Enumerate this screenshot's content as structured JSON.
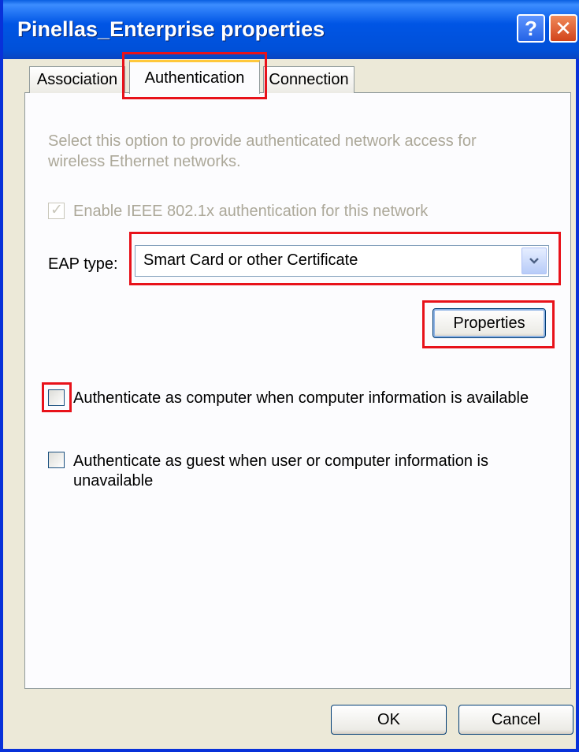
{
  "window": {
    "title": "Pinellas_Enterprise properties",
    "help_label": "?",
    "close_label": "✕"
  },
  "tabs": [
    {
      "label": "Association"
    },
    {
      "label": "Authentication"
    },
    {
      "label": "Connection"
    }
  ],
  "auth": {
    "description": "Select this option to provide authenticated network access for wireless Ethernet networks.",
    "enable_ieee_label": "Enable IEEE 802.1x authentication for this network",
    "enable_ieee_checked": true,
    "eap_type_label": "EAP type:",
    "eap_type_value": "Smart Card or other Certificate",
    "properties_label": "Properties",
    "auth_computer_label": "Authenticate as computer when computer information is available",
    "auth_computer_checked": false,
    "auth_guest_label": "Authenticate as guest when user or computer information is unavailable",
    "auth_guest_checked": false
  },
  "footer": {
    "ok_label": "OK",
    "cancel_label": "Cancel"
  },
  "colors": {
    "titlebar": "#0055e5",
    "highlight": "#e8121a",
    "tab_accent": "#ffc83c"
  }
}
